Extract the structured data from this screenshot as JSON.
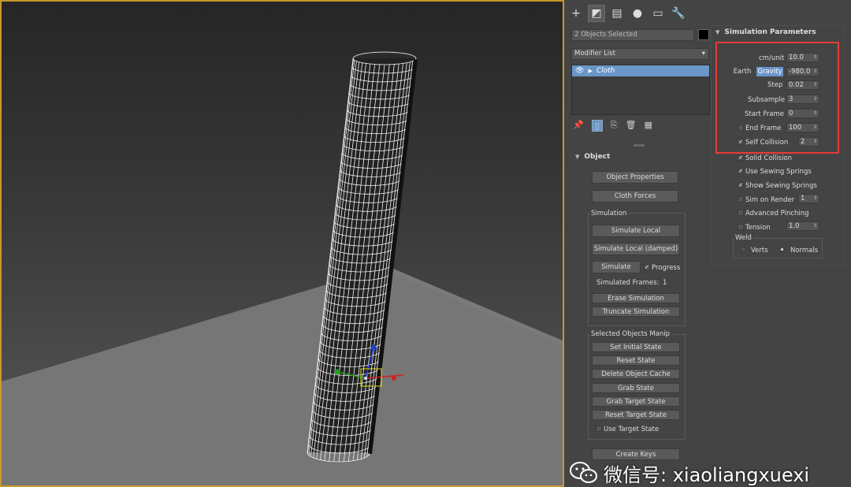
{
  "toolbar": {
    "tabs": [
      {
        "icon": "create-plus-icon",
        "glyph": "+"
      },
      {
        "icon": "modify-icon",
        "glyph": "◩"
      },
      {
        "icon": "hierarchy-icon",
        "glyph": "▤"
      },
      {
        "icon": "motion-icon",
        "glyph": "●"
      },
      {
        "icon": "display-icon",
        "glyph": "▭"
      },
      {
        "icon": "utilities-wrench-icon",
        "glyph": "🔧"
      }
    ]
  },
  "selection": {
    "text": "2 Objects Selected",
    "color_swatch": "#000000"
  },
  "modifier_list": {
    "label": "Modifier List",
    "dropdown_glyph": "▾"
  },
  "modifier_stack": {
    "items": [
      {
        "label": "Cloth",
        "highlight": "#6a96c8"
      }
    ]
  },
  "stack_tools": {
    "glyphs": [
      "📌",
      "|",
      "▯",
      "|",
      "🗑",
      "🗑",
      "▦"
    ]
  },
  "object_rollout": {
    "title": "Object",
    "object_properties": "Object Properties",
    "cloth_forces": "Cloth Forces",
    "simulation_group": "Simulation",
    "simulate_local": "Simulate Local",
    "simulate_local_damped": "Simulate Local (damped)",
    "simulate": "Simulate",
    "progress_label": "Progress",
    "simulated_frames_label": "Simulated Frames:",
    "simulated_frames_value": "1",
    "erase_simulation": "Erase Simulation",
    "truncate_simulation": "Truncate Simulation",
    "selected_manip_group": "Selected Objects Manip",
    "set_initial_state": "Set Initial State",
    "reset_state": "Reset State",
    "delete_object_cache": "Delete Object Cache",
    "grab_state": "Grab State",
    "grab_target_state": "Grab Target State",
    "reset_target_state": "Reset Target State",
    "use_target_state": "Use Target State",
    "create_keys": "Create Keys"
  },
  "sim_params": {
    "title": "Simulation Parameters",
    "cm_unit_label": "cm/unit",
    "cm_unit_value": "10.0",
    "earth_label": "Earth",
    "gravity_label": "Gravity",
    "gravity_value": "-980.0",
    "step_label": "Step",
    "step_value": "0.02",
    "subsample_label": "Subsample",
    "subsample_value": "3",
    "start_frame_label": "Start Frame",
    "start_frame_value": "0",
    "end_frame_label": "End Frame",
    "end_frame_value": "100",
    "self_collision_label": "Self Collision",
    "self_collision_value": "2",
    "solid_collision_label": "Solid Collision",
    "use_sewing_springs_label": "Use Sewing Springs",
    "show_sewing_springs_label": "Show Sewing Springs",
    "sim_on_render_label": "Sim on Render",
    "sim_on_render_value": "1",
    "advanced_pinching_label": "Advanced Pinching",
    "tension_label": "Tension",
    "tension_value": "1.0",
    "weld_label": "Weld",
    "verts_label": "Verts",
    "normals_label": "Normals",
    "highlight_color": "#e83a3a"
  },
  "watermark": {
    "text": "微信号: xiaoliangxuexi",
    "icon": "wechat-icon"
  },
  "colors": {
    "viewport_border": "#c79a2c",
    "accent": "#6a96c8"
  }
}
